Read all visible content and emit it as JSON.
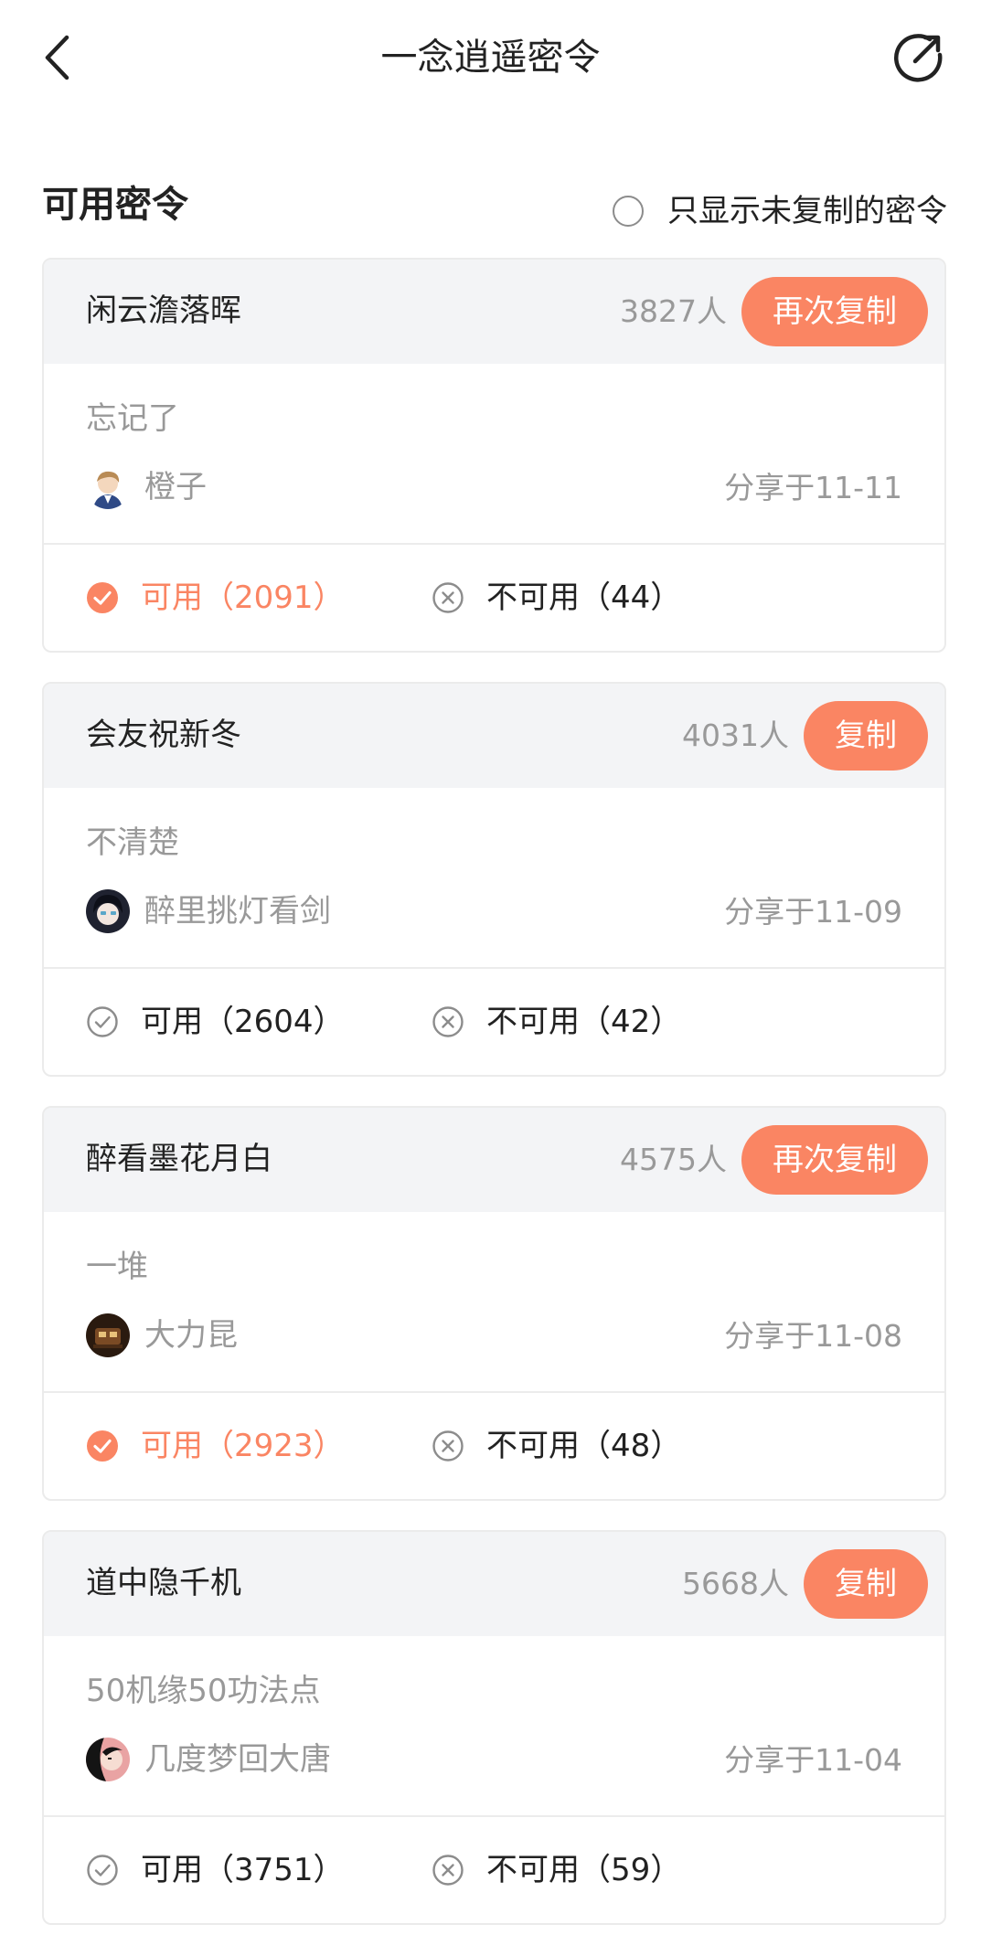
{
  "header": {
    "title": "一念逍遥密令",
    "back_icon": "chevron-left-icon",
    "share_icon": "share-arrow-icon"
  },
  "section": {
    "title": "可用密令",
    "filter_label": "只显示未复制的密令",
    "filter_checked": false
  },
  "colors": {
    "accent": "#fa8563",
    "header_bg": "#f3f4f6",
    "muted_text": "#999999"
  },
  "cards": [
    {
      "code": "闲云澹落晖",
      "count": "3827人",
      "button_label": "再次复制",
      "description": "忘记了",
      "author": "橙子",
      "date": "分享于11-11",
      "valid_label": "可用（2091）",
      "invalid_label": "不可用（44）",
      "valid_selected": true
    },
    {
      "code": "会友祝新冬",
      "count": "4031人",
      "button_label": "复制",
      "description": "不清楚",
      "author": "醉里挑灯看剑",
      "date": "分享于11-09",
      "valid_label": "可用（2604）",
      "invalid_label": "不可用（42）",
      "valid_selected": false
    },
    {
      "code": "醉看墨花月白",
      "count": "4575人",
      "button_label": "再次复制",
      "description": "一堆",
      "author": "大力昆",
      "date": "分享于11-08",
      "valid_label": "可用（2923）",
      "invalid_label": "不可用（48）",
      "valid_selected": true
    },
    {
      "code": "道中隐千机",
      "count": "5668人",
      "button_label": "复制",
      "description": "50机缘50功法点",
      "author": "几度梦回大唐",
      "date": "分享于11-04",
      "valid_label": "可用（3751）",
      "invalid_label": "不可用（59）",
      "valid_selected": false
    }
  ]
}
